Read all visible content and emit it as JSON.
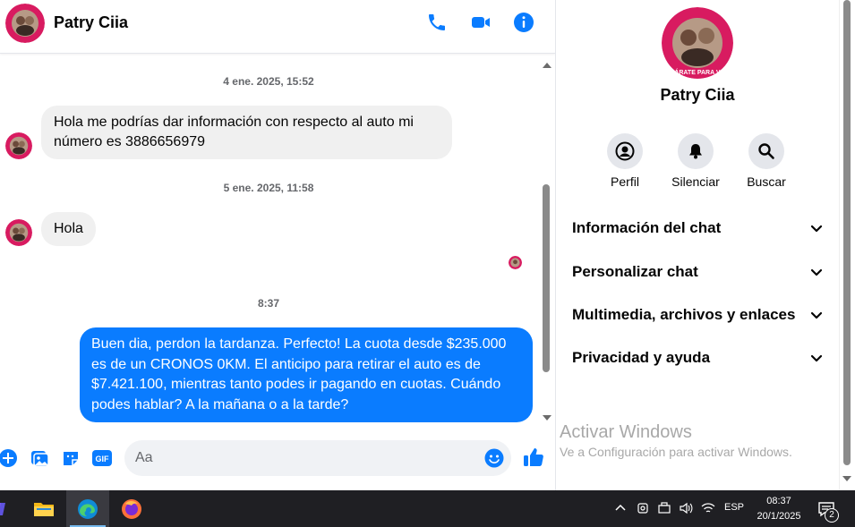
{
  "colors": {
    "accent": "#0a7cff",
    "outgoing_bubble": "#0a7cff",
    "incoming_bubble": "#f0f0f0",
    "messenger_blue": "#0084ff",
    "taskbar": "#1f1f23"
  },
  "header": {
    "contact_name": "Patry Ciia",
    "icons": [
      "phone-icon",
      "video-camera-icon",
      "info-icon"
    ]
  },
  "avatar_text": "PREPÁRATE PARA VOTAR",
  "messages": [
    {
      "type": "timestamp",
      "text": "4 ene. 2025, 15:52"
    },
    {
      "type": "incoming",
      "text": "Hola me podrías dar información con respecto al auto mi número es 3886656979"
    },
    {
      "type": "timestamp",
      "text": "5 ene. 2025, 11:58"
    },
    {
      "type": "incoming",
      "text": "Hola"
    },
    {
      "type": "timestamp",
      "text": "8:37"
    },
    {
      "type": "outgoing",
      "text": "Buen dia, perdon la tardanza. Perfecto! La cuota desde $235.000 es de un CRONOS 0KM. El anticipo para retirar el auto es de $7.421.100, mientras tanto podes ir pagando en cuotas. Cuándo podes hablar? A la mañana o a la tarde?"
    }
  ],
  "composer": {
    "placeholder": "Aa",
    "value": "",
    "icons": [
      "plus-icon",
      "image-icon",
      "sticker-icon",
      "gif-icon",
      "emoji-icon",
      "thumbs-up-icon"
    ],
    "gif_label": "GIF"
  },
  "info_panel": {
    "name": "Patry Ciia",
    "actions": [
      {
        "label": "Perfil",
        "icon": "profile-icon"
      },
      {
        "label": "Silenciar",
        "icon": "bell-icon"
      },
      {
        "label": "Buscar",
        "icon": "search-icon"
      }
    ],
    "sections": [
      {
        "label": "Información del chat"
      },
      {
        "label": "Personalizar chat"
      },
      {
        "label": "Multimedia, archivos y enlaces"
      },
      {
        "label": "Privacidad y ayuda"
      }
    ]
  },
  "watermark": {
    "title": "Activar Windows",
    "subtitle": "Ve a Configuración para activar Windows."
  },
  "taskbar": {
    "apps": [
      "copilot-icon",
      "file-explorer-icon",
      "edge-icon",
      "firefox-icon"
    ],
    "active_app": "edge-icon",
    "language": "ESP",
    "time": "08:37",
    "date": "20/1/2025",
    "notification_count": "2"
  }
}
